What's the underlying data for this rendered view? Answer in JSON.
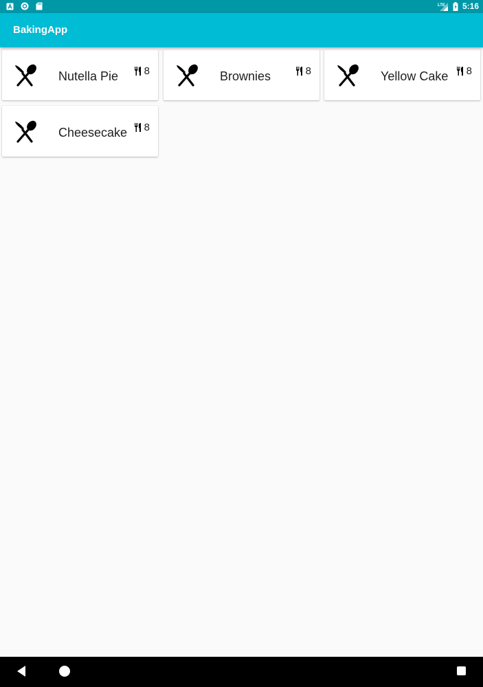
{
  "status_bar": {
    "time": "5:16",
    "network": "LTE",
    "left_icons": [
      "app-notification-icon",
      "sync-notification-icon",
      "sd-card-icon"
    ],
    "right_icons": [
      "lte-signal-icon",
      "battery-icon"
    ]
  },
  "app_bar": {
    "title": "BakingApp",
    "color": "#00bcd4",
    "status_color": "#0097a7"
  },
  "recipes": [
    {
      "name": "Nutella Pie",
      "servings": "8",
      "icon": "cutlery-icon",
      "servings_icon": "restaurant-icon"
    },
    {
      "name": "Brownies",
      "servings": "8",
      "icon": "cutlery-icon",
      "servings_icon": "restaurant-icon"
    },
    {
      "name": "Yellow Cake",
      "servings": "8",
      "icon": "cutlery-icon",
      "servings_icon": "restaurant-icon"
    },
    {
      "name": "Cheesecake",
      "servings": "8",
      "icon": "cutlery-icon",
      "servings_icon": "restaurant-icon"
    }
  ],
  "nav_bar": {
    "buttons": [
      "back-icon",
      "home-icon",
      "recents-icon"
    ]
  }
}
